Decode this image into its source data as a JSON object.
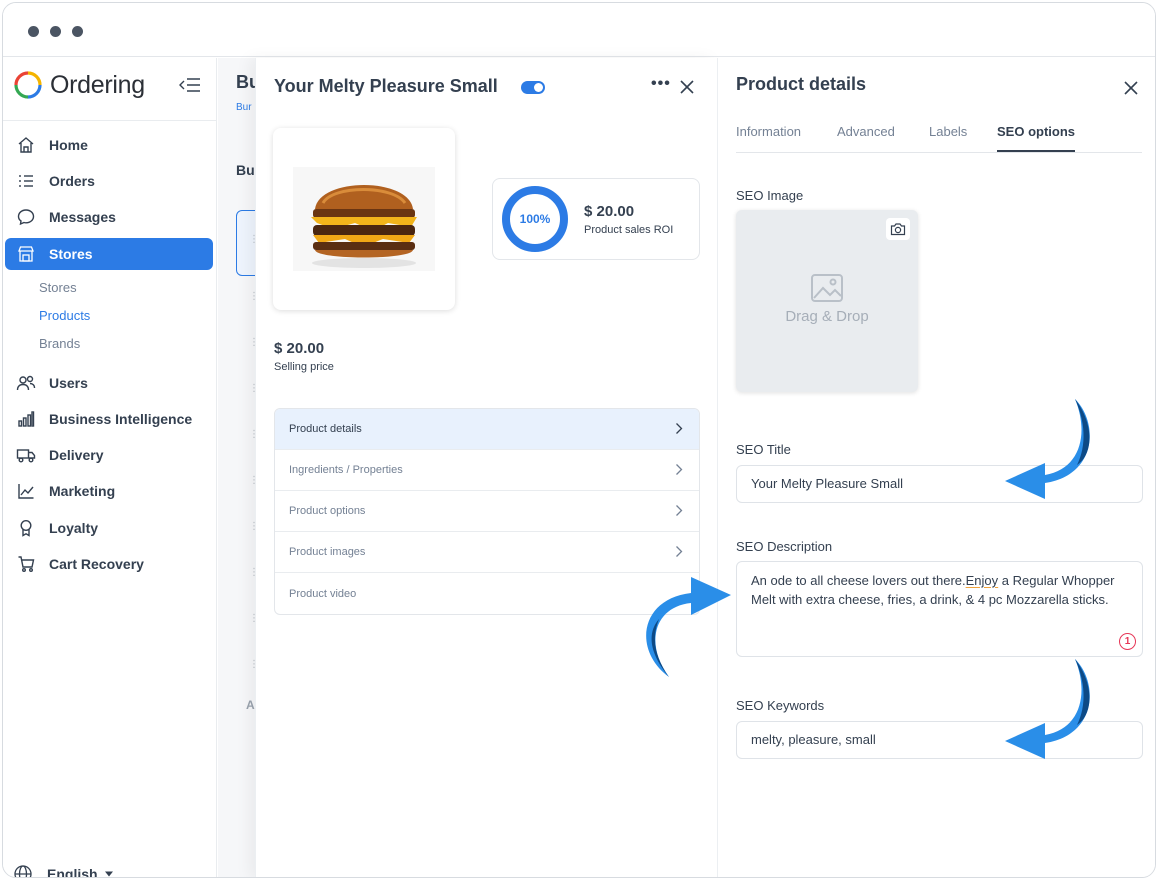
{
  "sidebar": {
    "logo": "Ordering",
    "nav": [
      {
        "label": "Home"
      },
      {
        "label": "Orders"
      },
      {
        "label": "Messages"
      },
      {
        "label": "Stores"
      },
      {
        "label": "Users"
      },
      {
        "label": "Business Intelligence"
      },
      {
        "label": "Delivery"
      },
      {
        "label": "Marketing"
      },
      {
        "label": "Loyalty"
      },
      {
        "label": "Cart Recovery"
      }
    ],
    "stores_sub": [
      "Stores",
      "Products",
      "Brands"
    ],
    "language": "English"
  },
  "background": {
    "title_fragment": "Bu",
    "breadcrumb_fragment": "Bur",
    "section_fragment": "Bus",
    "footer_fragment": "A"
  },
  "product": {
    "title": "Your Melty Pleasure Small",
    "roi_percent": "100%",
    "roi_value": "$ 20.00",
    "roi_label": "Product sales ROI",
    "price_value": "$ 20.00",
    "price_label": "Selling price",
    "menu": [
      "Product details",
      "Ingredients / Properties",
      "Product options",
      "Product images",
      "Product video"
    ]
  },
  "details": {
    "title": "Product details",
    "tabs": [
      "Information",
      "Advanced",
      "Labels",
      "SEO options"
    ],
    "seo_image_label": "SEO Image",
    "drag_drop": "Drag & Drop",
    "seo_title_label": "SEO Title",
    "seo_title_value": "Your Melty Pleasure Small",
    "seo_description_label": "SEO Description",
    "seo_description_part1": "An ode to all cheese lovers out there.",
    "seo_description_spell": "Enjoy",
    "seo_description_part2": " a Regular Whopper Melt with extra cheese, fries, a drink, & 4 pc Mozzarella sticks.",
    "error_count": "1",
    "seo_keywords_label": "SEO Keywords",
    "seo_keywords_value": "melty, pleasure, small"
  },
  "colors": {
    "accent": "#2c7be5",
    "arrow": "#2a8ee8",
    "arrow_dark": "#0d4a86",
    "error": "#e63757"
  }
}
